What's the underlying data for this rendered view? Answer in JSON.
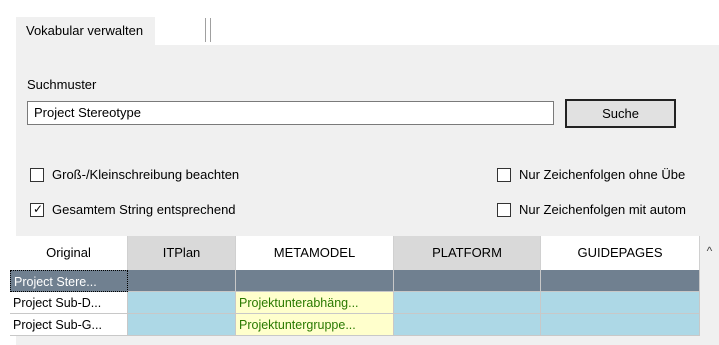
{
  "tab": {
    "label": "Vokabular verwalten"
  },
  "search": {
    "label": "Suchmuster",
    "value": "Project Stereotype",
    "button": "Suche"
  },
  "options": {
    "case": {
      "label": "Groß-/Kleinschreibung beachten",
      "checked": false
    },
    "whole": {
      "label": "Gesamtem String entsprechend",
      "checked": true
    },
    "no_over": {
      "label": "Nur Zeichenfolgen ohne Übe",
      "checked": false
    },
    "auto": {
      "label": "Nur Zeichenfolgen mit autom",
      "checked": false
    }
  },
  "table": {
    "columns": [
      "Original",
      "ITPlan",
      "METAMODEL",
      "PLATFORM",
      "GUIDEPAGES"
    ],
    "rows": [
      [
        "Project Stere...",
        "",
        "",
        "",
        ""
      ],
      [
        "Project Sub-D...",
        "",
        "Projektunterabhäng...",
        "",
        ""
      ],
      [
        "Project Sub-G...",
        "",
        "Projektuntergruppe...",
        "",
        ""
      ]
    ]
  },
  "colors": {
    "selected_row": "#708090",
    "cell_fill": "#add8e6",
    "highlight_fill": "#ffffcc",
    "highlight_text": "#2a7a00"
  }
}
